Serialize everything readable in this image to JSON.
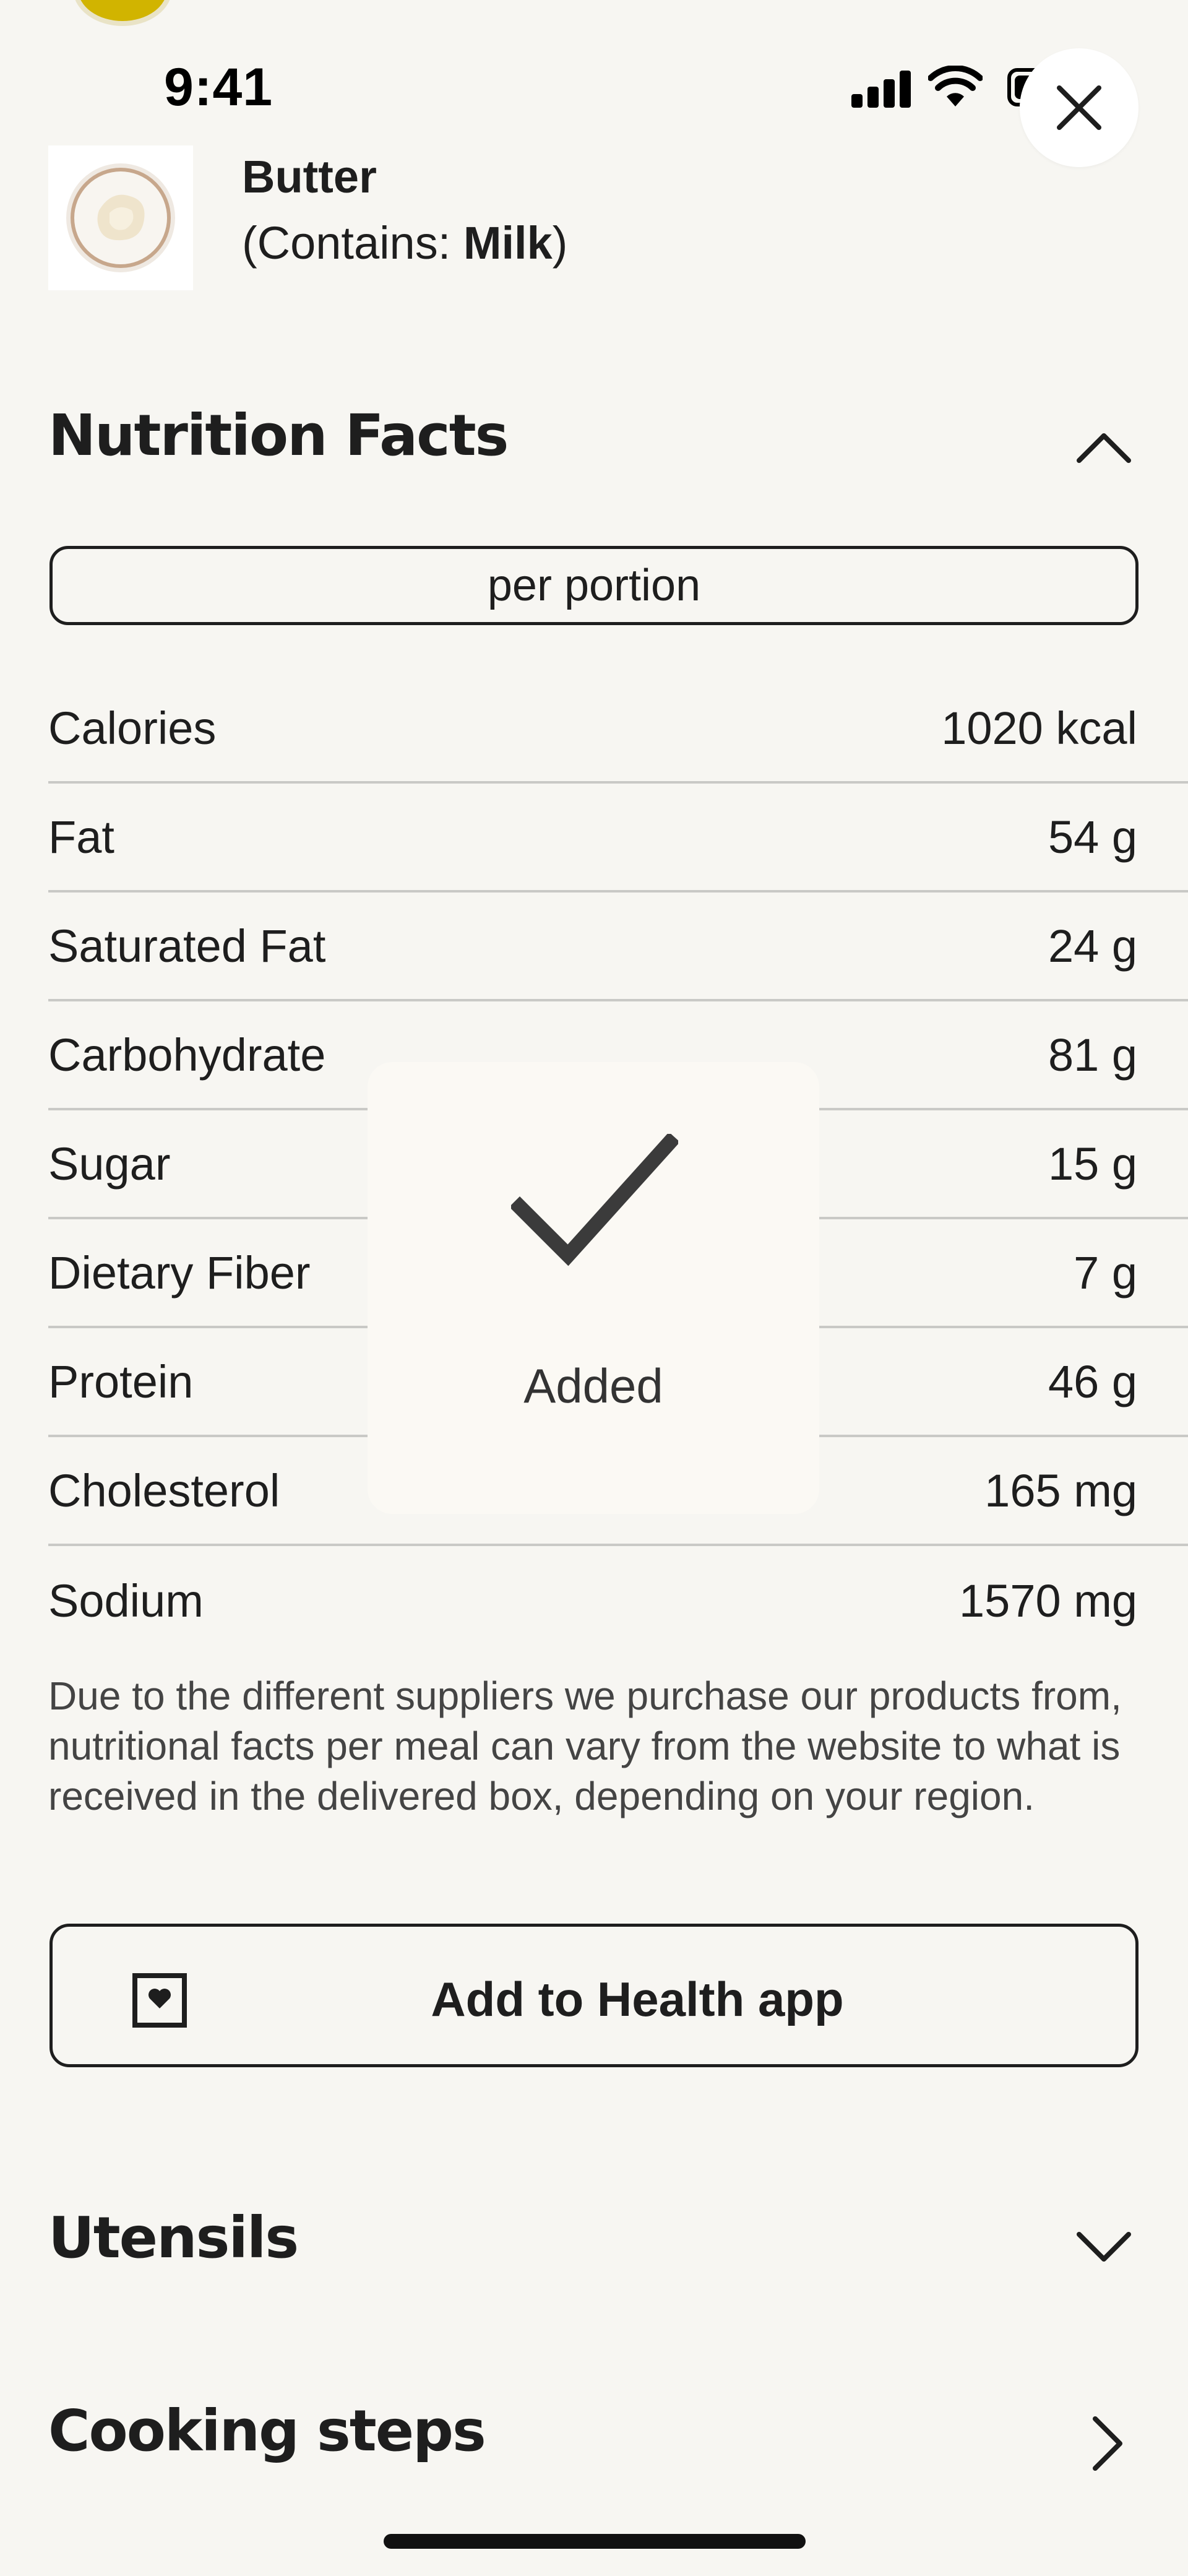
{
  "status_bar": {
    "time": "9:41"
  },
  "ingredient": {
    "name": "Butter",
    "allergen_prefix": "(Contains: ",
    "allergen": "Milk",
    "allergen_suffix": ")"
  },
  "nutrition": {
    "title": "Nutrition Facts",
    "portion_toggle": "per portion",
    "rows": [
      {
        "label": "Calories",
        "value": "1020 kcal"
      },
      {
        "label": "Fat",
        "value": "54 g"
      },
      {
        "label": "Saturated Fat",
        "value": "24 g"
      },
      {
        "label": "Carbohydrate",
        "value": "81 g"
      },
      {
        "label": "Sugar",
        "value": "15 g"
      },
      {
        "label": "Dietary Fiber",
        "value": "7 g"
      },
      {
        "label": "Protein",
        "value": "46 g"
      },
      {
        "label": "Cholesterol",
        "value": "165 mg"
      },
      {
        "label": "Sodium",
        "value": "1570 mg"
      }
    ],
    "disclaimer": "Due to the different suppliers we purchase our products from, nutritional facts per meal can vary from the website to what is received in the delivered box, depending on your region.",
    "health_button": "Add to Health app"
  },
  "sections": {
    "utensils": "Utensils",
    "cooking_steps": "Cooking steps"
  },
  "toast": {
    "label": "Added"
  },
  "icons": {
    "close": "close-icon",
    "collapse": "chevron-up-icon",
    "expand": "chevron-down-icon",
    "navigate": "chevron-right-icon",
    "health": "health-app-icon",
    "added": "checkmark-icon"
  },
  "colors": {
    "background": "#f7f6f2",
    "text": "#1e1e1e",
    "divider": "#c9c9c6"
  }
}
